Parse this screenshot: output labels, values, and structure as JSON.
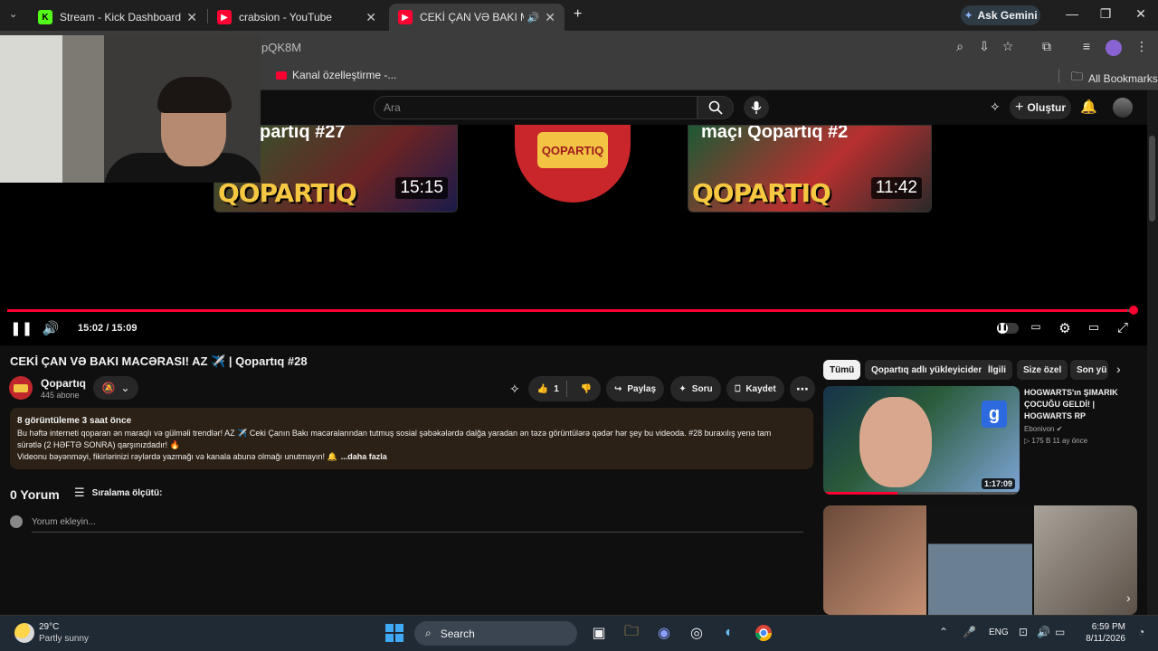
{
  "browser": {
    "tabs": [
      {
        "title": "Stream - Kick Dashboard",
        "icon": "kick-icon"
      },
      {
        "title": "crabsion - YouTube",
        "icon": "youtube-icon"
      },
      {
        "title": "CEKİ ÇAN VƏ BAKI MACƏR",
        "icon": "youtube-icon"
      }
    ],
    "new_tab": "+",
    "gemini_label": "Ask Gemini",
    "url": "pQK8M",
    "bookmark_1": "Kanal özelleştirme -...",
    "all_bookmarks": "All Bookmarks"
  },
  "youtube": {
    "search_placeholder": "Ara",
    "create_label": "Oluştur",
    "brand_color": "#ff0033"
  },
  "player": {
    "end_cards": [
      {
        "brand": "QOPARTIQ",
        "duration": "15:15",
        "caption": "partiq #27"
      },
      {
        "brand": "QOPARTIQ",
        "duration": "11:42",
        "caption": "maçı Qopartıq #2"
      }
    ],
    "end_logo": "QOPARTIQ",
    "time": "15:02 / 15:09",
    "progress": 0.992
  },
  "video": {
    "title": "CEKİ ÇAN VƏ BAKI MACƏRASI! AZ ✈️ | Qopartıq #28",
    "channel": "Qopartıq",
    "subscribers": "445 abone",
    "likes": "1",
    "share": "Paylaş",
    "ask": "Soru",
    "save": "Kaydet",
    "description": {
      "meta": "8 görüntüleme  3 saat önce",
      "line1": "Bu həftə interneti qoparan ən maraqlı və gülməli trendlər! AZ ✈️ Ceki Çanın Bakı macəralarından tutmuş sosial şəbəkələrdə dalğa yaradan ən təzə görüntülərə qədər hər şey bu videoda. #28 buraxılış yenə tam",
      "line2": "sürətlə (2 HƏFTƏ SONRA) qarşınızdadır! 🔥",
      "line3": "Videonu bəyənməyi, fikirlərinizi rəylərdə yazmağı və kanala abunə olmağı unutmayın! 🔔",
      "more": "...daha fazla"
    }
  },
  "comments": {
    "count": "0 Yorum",
    "sort": "Sıralama ölçütü:",
    "placeholder": "Yorum ekleyin..."
  },
  "sidebar": {
    "chips": [
      "Tümü",
      "Qopartıq adlı yükleyiciden",
      "İlgili",
      "Size özel",
      "Son yü"
    ],
    "rec1": {
      "title": "HOGWARTS'ın ŞIMARIK ÇOCUĞU GELDİ! | HOGWARTS RP",
      "channel": "Ebonivon ✔",
      "stats": "▷ 175 B   11 ay önce",
      "duration": "1:17:09",
      "watched": 0.38
    }
  },
  "taskbar": {
    "temp": "29°C",
    "weather": "Partly sunny",
    "search": "Search",
    "lang": "ENG",
    "time": "6:59 PM",
    "date": "8/11/2026"
  }
}
